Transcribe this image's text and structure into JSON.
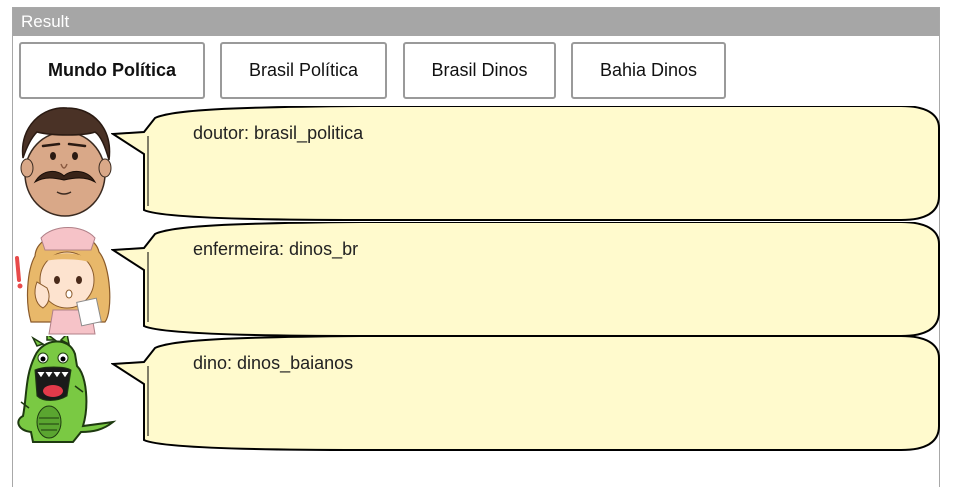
{
  "panel": {
    "title": "Result"
  },
  "tabs": [
    {
      "label": "Mundo Política",
      "active": true
    },
    {
      "label": "Brasil Política",
      "active": false
    },
    {
      "label": "Brasil Dinos",
      "active": false
    },
    {
      "label": "Bahia Dinos",
      "active": false
    }
  ],
  "messages": [
    {
      "speaker_icon": "doctor-avatar-icon",
      "text": "doutor: brasil_politica"
    },
    {
      "speaker_icon": "nurse-avatar-icon",
      "text": "enfermeira: dinos_br"
    },
    {
      "speaker_icon": "dinosaur-avatar-icon",
      "text": "dino: dinos_baianos"
    }
  ],
  "colors": {
    "bubble_fill": "#fffacd",
    "bubble_stroke": "#000000",
    "header_bg": "#a6a6a6"
  }
}
